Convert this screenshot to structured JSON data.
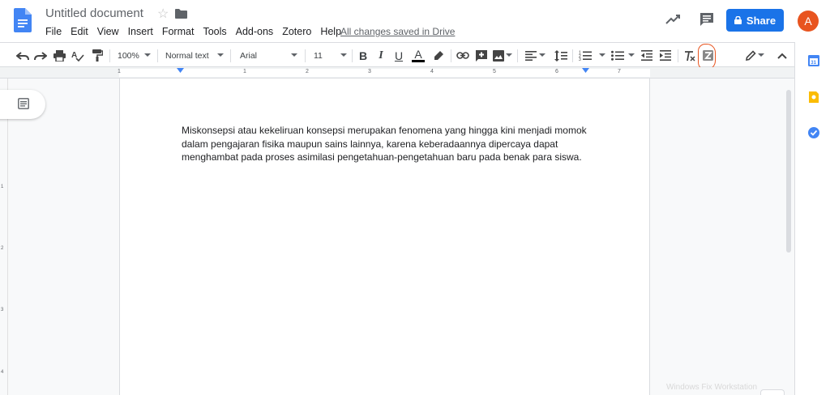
{
  "header": {
    "title": "Untitled document",
    "saved_status": "All changes saved in Drive",
    "share_label": "Share",
    "avatar_letter": "A",
    "brand_color": "#1a73e8",
    "avatar_color": "#e8541f"
  },
  "menu": [
    "File",
    "Edit",
    "View",
    "Insert",
    "Format",
    "Tools",
    "Add-ons",
    "Zotero",
    "Help"
  ],
  "toolbar": {
    "zoom": "100%",
    "style": "Normal text",
    "font": "Arial",
    "font_size": "11",
    "bold": "B",
    "italic": "I",
    "underline": "U",
    "text_color": "A",
    "icons": [
      "undo-icon",
      "redo-icon",
      "print-icon",
      "spellcheck-icon",
      "paint-format-icon",
      "link-icon",
      "insert-comment-icon",
      "insert-image-icon",
      "align-icon",
      "line-spacing-icon",
      "numbered-list-icon",
      "bulleted-list-icon",
      "decrease-indent-icon",
      "increase-indent-icon",
      "clear-formatting-icon",
      "zotero-icon",
      "editing-mode-icon",
      "collapse-icon"
    ]
  },
  "ruler": {
    "h_marks": [
      "1",
      "1",
      "2",
      "3",
      "4",
      "5",
      "6",
      "7"
    ],
    "v_marks": [
      "1",
      "2",
      "3",
      "4"
    ]
  },
  "document": {
    "body": "Miskonsepsi atau kekeliruan konsepsi merupakan fenomena yang hingga kini menjadi momok dalam pengajaran fisika maupun sains lainnya, karena keberadaannya dipercaya dapat menghambat pada proses asimilasi pengetahuan-pengetahuan baru pada benak para siswa."
  },
  "watermark": "Windows Fix Workstation"
}
